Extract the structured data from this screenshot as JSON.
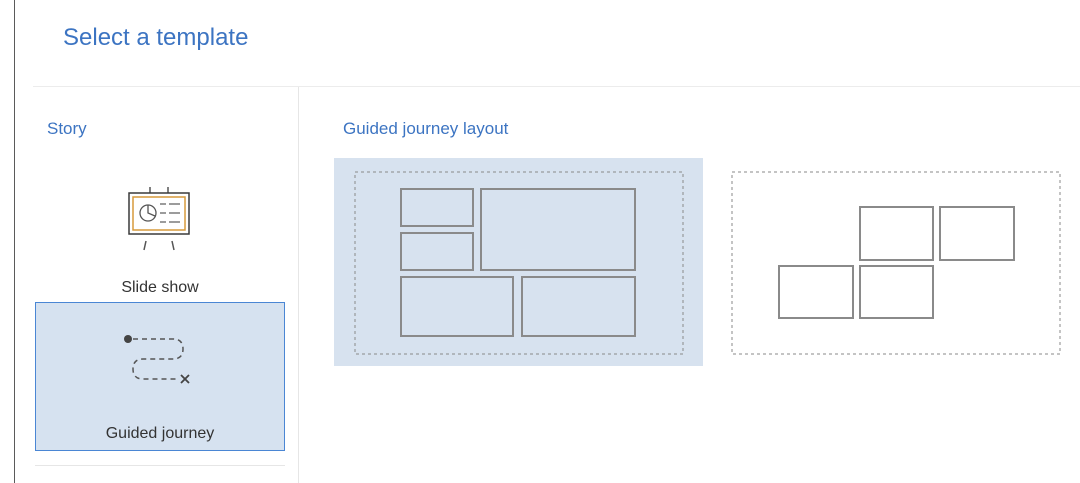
{
  "dialog": {
    "title": "Select a template"
  },
  "sidebar": {
    "section_label": "Story",
    "items": [
      {
        "label": "Slide show",
        "icon": "slideshow-icon",
        "selected": false
      },
      {
        "label": "Guided journey",
        "icon": "guided-journey-icon",
        "selected": true
      }
    ]
  },
  "main": {
    "section_label": "Guided journey layout",
    "layouts": [
      {
        "icon": "grid-layout-icon",
        "selected": true
      },
      {
        "icon": "staggered-layout-icon",
        "selected": false
      }
    ]
  },
  "colors": {
    "accent": "#3c74c2",
    "selected_bg": "#d6e2f0",
    "selected_border": "#4a86d4"
  }
}
